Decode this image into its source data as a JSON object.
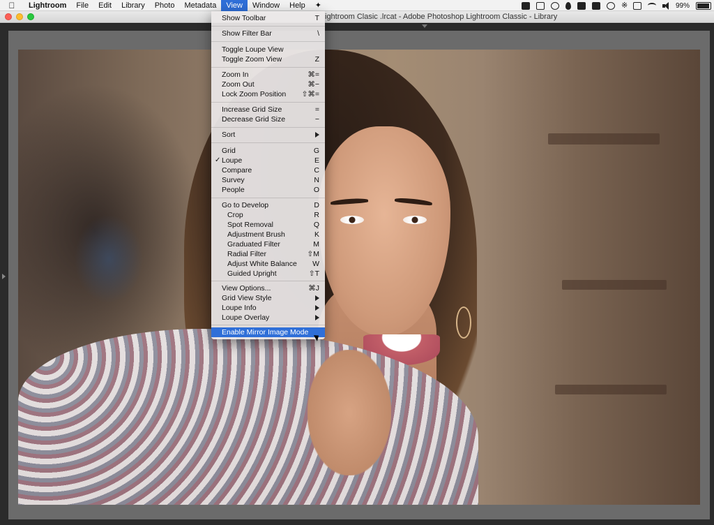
{
  "menubar": {
    "apple_icon": "apple-logo",
    "items": [
      "Lightroom",
      "File",
      "Edit",
      "Library",
      "Photo",
      "Metadata",
      "View",
      "Window",
      "Help"
    ],
    "active_item": "View",
    "battery": "99%"
  },
  "window": {
    "title": "ightroom Clasic .lrcat - Adobe Photoshop Lightroom Classic - Library"
  },
  "view_menu": {
    "items": [
      {
        "label": "Show Toolbar",
        "shortcut": "T"
      },
      {
        "label": "Show Filter Bar",
        "shortcut": "\\"
      },
      {
        "label": "Toggle Loupe View",
        "shortcut": ""
      },
      {
        "label": "Toggle Zoom View",
        "shortcut": "Z"
      },
      {
        "label": "Zoom In",
        "shortcut": "⌘="
      },
      {
        "label": "Zoom Out",
        "shortcut": "⌘−"
      },
      {
        "label": "Lock Zoom Position",
        "shortcut": "⇧⌘="
      },
      {
        "label": "Increase Grid Size",
        "shortcut": "="
      },
      {
        "label": "Decrease Grid Size",
        "shortcut": "−"
      },
      {
        "label": "Sort",
        "shortcut": ""
      },
      {
        "label": "Grid",
        "shortcut": "G"
      },
      {
        "label": "Loupe",
        "shortcut": "E",
        "checked": "✓"
      },
      {
        "label": "Compare",
        "shortcut": "C"
      },
      {
        "label": "Survey",
        "shortcut": "N"
      },
      {
        "label": "People",
        "shortcut": "O"
      },
      {
        "label": "Go to Develop",
        "shortcut": "D"
      },
      {
        "label": "Crop",
        "shortcut": "R"
      },
      {
        "label": "Spot Removal",
        "shortcut": "Q"
      },
      {
        "label": "Adjustment Brush",
        "shortcut": "K"
      },
      {
        "label": "Graduated Filter",
        "shortcut": "M"
      },
      {
        "label": "Radial Filter",
        "shortcut": "⇧M"
      },
      {
        "label": "Adjust White Balance",
        "shortcut": "W"
      },
      {
        "label": "Guided Upright",
        "shortcut": "⇧T"
      },
      {
        "label": "View Options...",
        "shortcut": "⌘J"
      },
      {
        "label": "Grid View Style",
        "shortcut": ""
      },
      {
        "label": "Loupe Info",
        "shortcut": ""
      },
      {
        "label": "Loupe Overlay",
        "shortcut": ""
      },
      {
        "label": "Enable Mirror Image Mode",
        "shortcut": ""
      }
    ]
  },
  "colors": {
    "accent": "#2f6fd8",
    "menu_bg": "#ece8e8"
  }
}
